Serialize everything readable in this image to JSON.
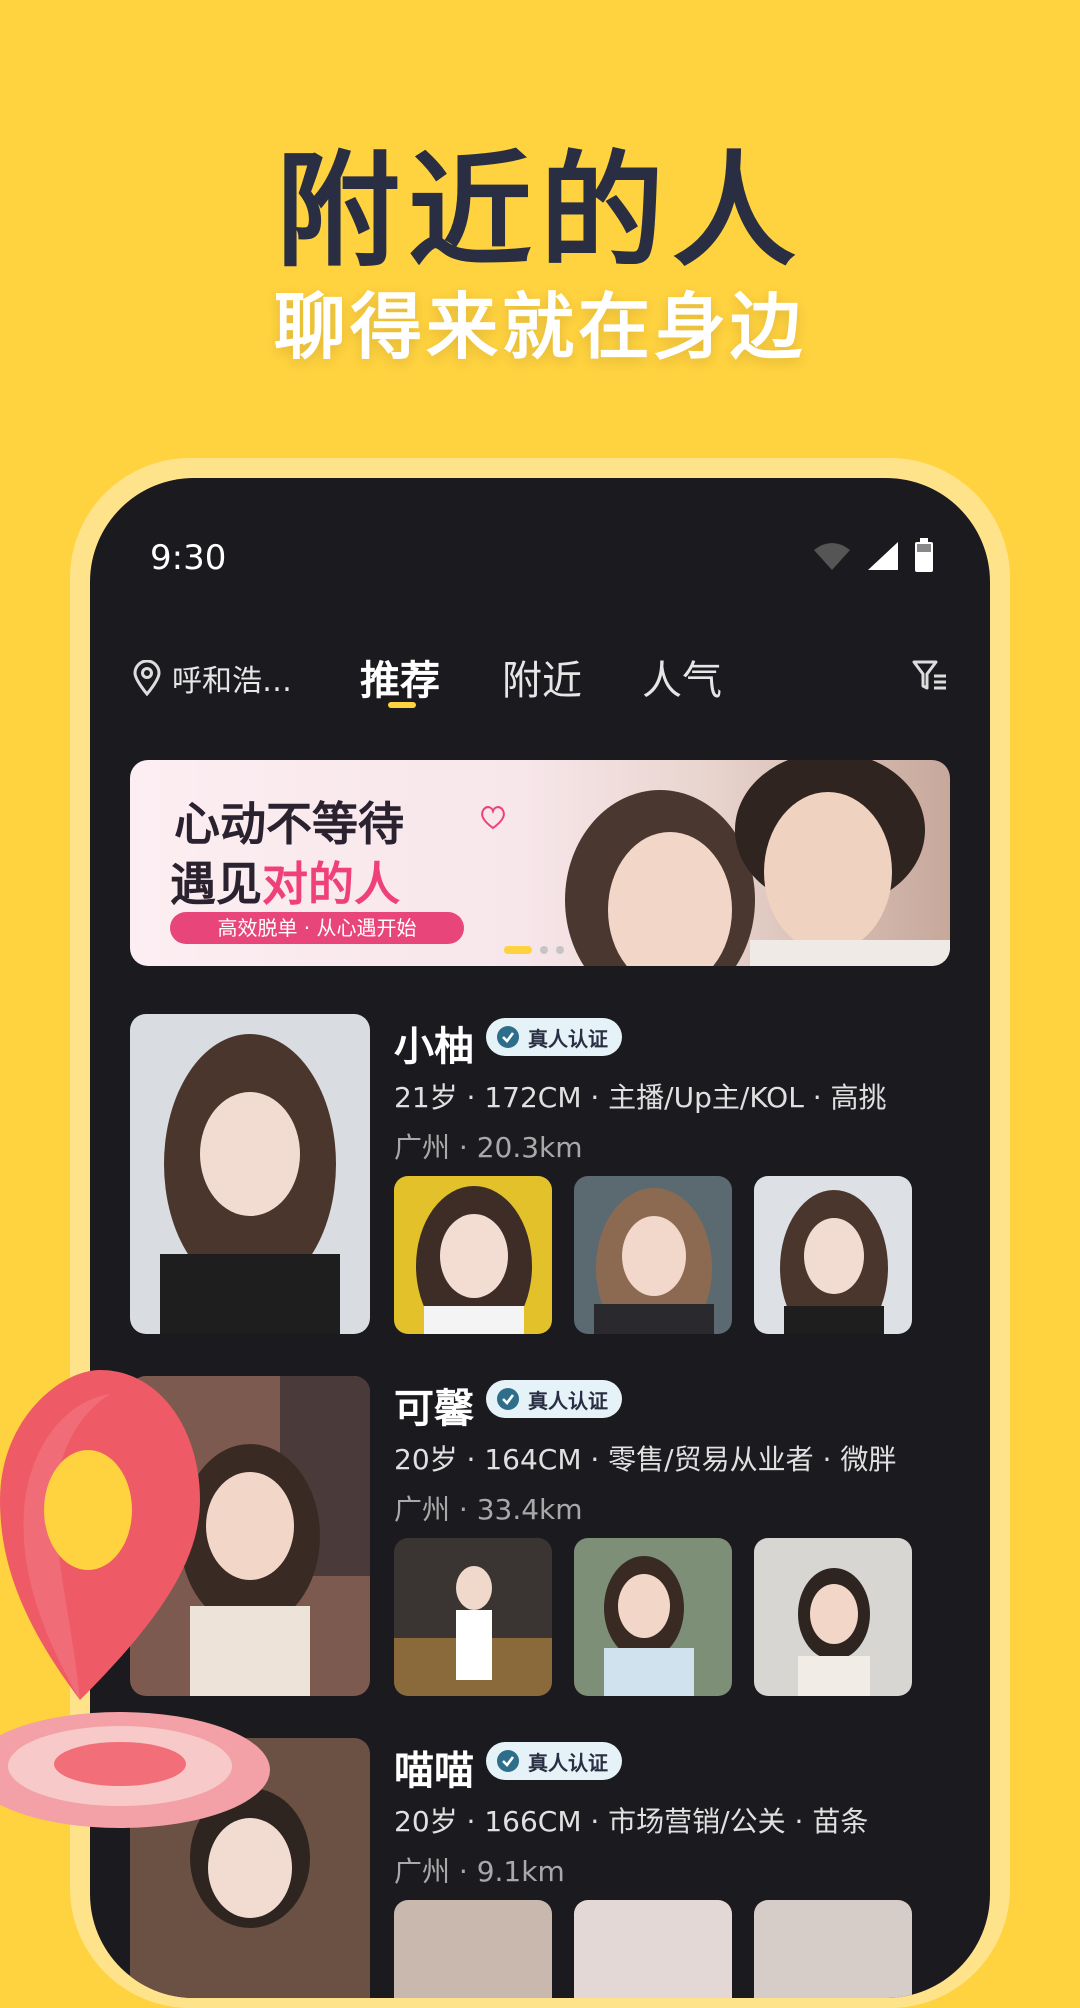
{
  "headline": "附近的人",
  "subheadline": "聊得来就在身边",
  "status_bar": {
    "time": "9:30"
  },
  "top_bar": {
    "location": "呼和浩…",
    "tabs": [
      {
        "label": "推荐",
        "active": true
      },
      {
        "label": "附近",
        "active": false
      },
      {
        "label": "人气",
        "active": false
      }
    ]
  },
  "banner": {
    "line1": "心动不等待",
    "line2_prefix": "遇见",
    "line2_highlight": "对的人",
    "tag": "高效脱单 · 从心遇开始",
    "slides_total": 3,
    "slide_active": 1
  },
  "users": [
    {
      "name": "小柚",
      "badge": "真人认证",
      "info": "21岁 · 172CM · 主播/Up主/KOL · 高挑",
      "location": "广州 · 20.3km"
    },
    {
      "name": "可馨",
      "badge": "真人认证",
      "info": "20岁 · 164CM · 零售/贸易从业者 · 微胖",
      "location": "广州 · 33.4km"
    },
    {
      "name": "喵喵",
      "badge": "真人认证",
      "info": "20岁 · 166CM · 市场营销/公关 · 苗条",
      "location": "广州 · 9.1km"
    }
  ],
  "colors": {
    "accent_yellow": "#FFD23F",
    "phone_bg": "#1B1B1F",
    "banner_pink": "#E8467B",
    "headline": "#2A2E43"
  },
  "icons": {
    "location": "location-pin-icon",
    "filter": "filter-icon",
    "verified": "verified-check-icon",
    "wifi": "wifi-icon",
    "signal": "signal-icon",
    "battery": "battery-icon"
  }
}
